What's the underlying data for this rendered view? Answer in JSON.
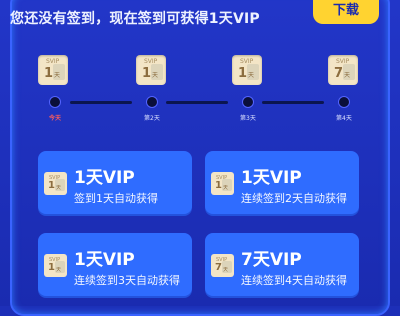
{
  "header": {
    "message": "您还没有签到，现在签到可获得1天VIP",
    "download_label": "下载"
  },
  "rewards_row": [
    {
      "label": "SVIP",
      "value": "1",
      "unit": "天"
    },
    {
      "label": "SVIP",
      "value": "1",
      "unit": "天"
    },
    {
      "label": "SVIP",
      "value": "1",
      "unit": "天"
    },
    {
      "label": "SVIP",
      "value": "7",
      "unit": "天"
    }
  ],
  "days": [
    {
      "label": "今天"
    },
    {
      "label": "第2天"
    },
    {
      "label": "第3天"
    },
    {
      "label": "第4天"
    }
  ],
  "cards": [
    {
      "head": "1天VIP",
      "desc": "签到1天自动获得",
      "mini": {
        "label": "SVIP",
        "value": "1",
        "unit": "天"
      }
    },
    {
      "head": "1天VIP",
      "desc": "连续签到2天自动获得",
      "mini": {
        "label": "SVIP",
        "value": "1",
        "unit": "天"
      }
    },
    {
      "head": "1天VIP",
      "desc": "连续签到3天自动获得",
      "mini": {
        "label": "SVIP",
        "value": "1",
        "unit": "天"
      }
    },
    {
      "head": "7天VIP",
      "desc": "连续签到4天自动获得",
      "mini": {
        "label": "SVIP",
        "value": "7",
        "unit": "天"
      }
    }
  ]
}
